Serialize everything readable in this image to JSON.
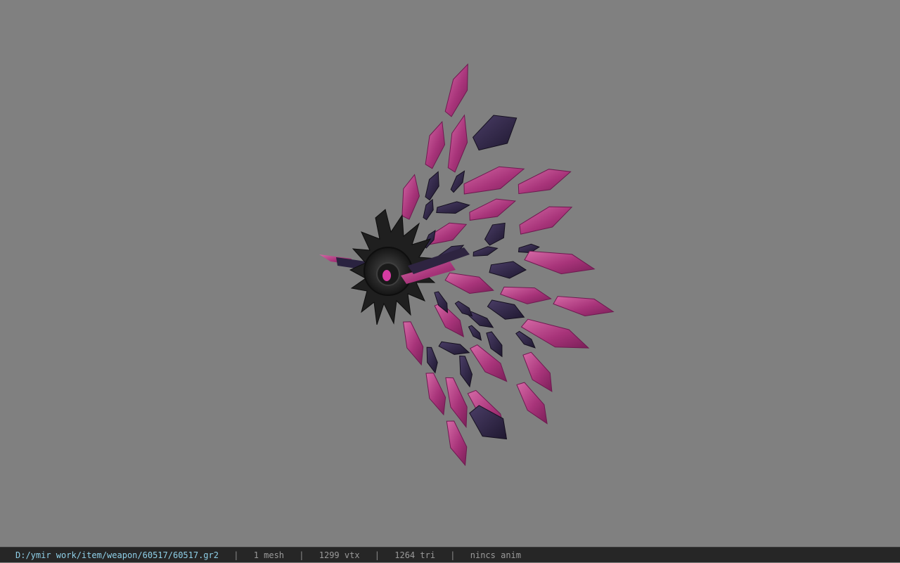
{
  "viewer": {
    "background_color": "#808080",
    "model_colors": {
      "magenta_crystal": "#b0407f",
      "magenta_highlight": "#d062a0",
      "dark_crystal": "#2e2440",
      "dark_highlight": "#4a3d66",
      "hub_metal": "#2a2a2a",
      "hub_gem": "#d73ba3"
    }
  },
  "statusbar": {
    "file_path": "D:/ymir work/item/weapon/60517/60517.gr2",
    "separator": "|",
    "mesh_count": "1 mesh",
    "vertex_count": "1299 vtx",
    "triangle_count": "1264 tri",
    "animation": "nincs anim"
  }
}
